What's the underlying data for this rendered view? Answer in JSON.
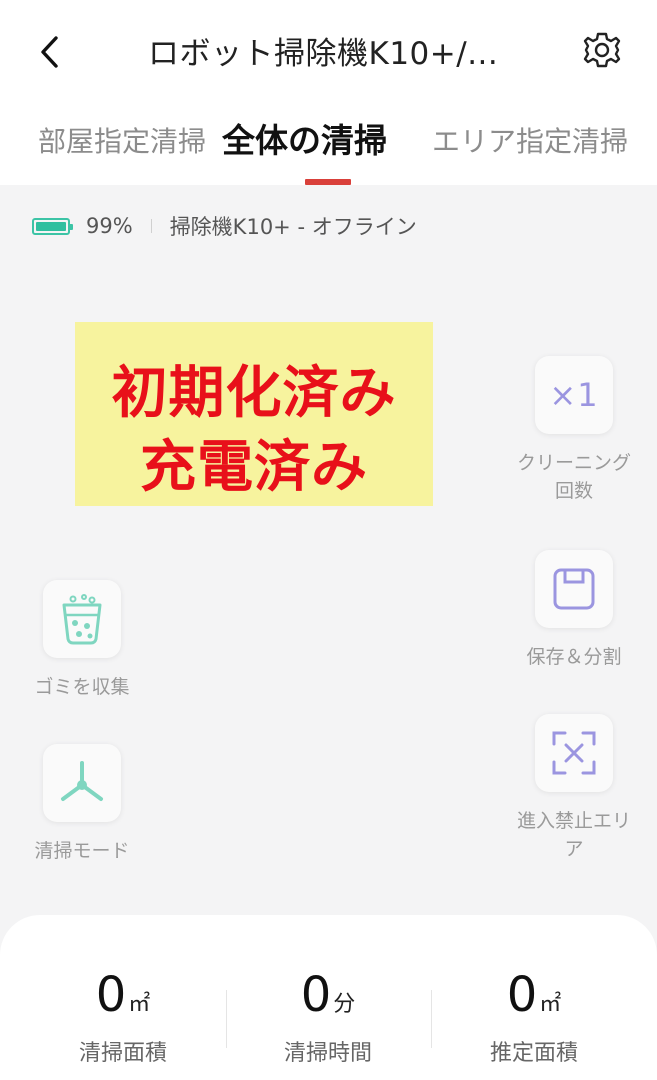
{
  "header": {
    "title": "ロボット掃除機K10+/...",
    "back_icon": "chevron-left-icon",
    "settings_icon": "gear-icon"
  },
  "tabs": {
    "left": "部屋指定清掃",
    "active": "全体の清掃",
    "active_clip": "ア",
    "right": "エリア指定清掃",
    "indicator_color": "#d9403a"
  },
  "status": {
    "battery_percent": "99%",
    "battery_level": 0.99,
    "device_status": "掃除機K10+ - オフライン",
    "battery_color": "#2fbf9f"
  },
  "overlay": {
    "line1": "初期化済み",
    "line2": "充電済み",
    "bg_color": "#f7f39e",
    "text_color": "#e8101a"
  },
  "actions": {
    "clean_count": {
      "label": "クリーニング回数",
      "label_line1": "クリーニング",
      "label_line2": "回数",
      "value": "×1"
    },
    "save_split": {
      "label": "保存＆分割"
    },
    "no_go_zone": {
      "label_line1": "進入禁止エリ",
      "label_line2": "ア"
    },
    "collect_dust": {
      "label": "ゴミを収集"
    },
    "clean_mode": {
      "label": "清掃モード"
    }
  },
  "stats": [
    {
      "value": "0",
      "unit": "㎡",
      "label": "清掃面積"
    },
    {
      "value": "0",
      "unit": "分",
      "label": "清掃時間"
    },
    {
      "value": "0",
      "unit": "㎡",
      "label": "推定面積"
    }
  ],
  "accent_purple": "#9b95e0",
  "accent_teal": "#7fd6c0"
}
